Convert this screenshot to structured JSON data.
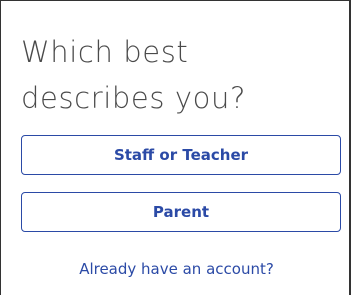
{
  "heading": "Which best describes you?",
  "options": [
    {
      "label": "Staff or Teacher"
    },
    {
      "label": "Parent"
    }
  ],
  "account_link": "Already have an account?",
  "colors": {
    "accent": "#2b4aa6",
    "heading_text": "#4a4a4a",
    "background": "#ffffff"
  }
}
